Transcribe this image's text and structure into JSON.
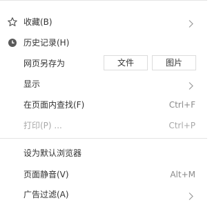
{
  "menu": {
    "items": [
      {
        "label": "收藏(B)",
        "icon": "star-icon",
        "submenu": true
      },
      {
        "label": "历史记录(H)",
        "icon": "history-clock-icon"
      },
      {
        "label": "网页另存为",
        "buttons": [
          "文件",
          "图片"
        ]
      },
      {
        "label": "显示",
        "submenu": true
      },
      {
        "label": "在页面内查找(F)",
        "shortcut": "Ctrl+F"
      },
      {
        "label": "打印(P) ...",
        "shortcut": "Ctrl+P",
        "disabled": true
      },
      {
        "label": "设为默认浏览器"
      },
      {
        "label": "页面静音(V)",
        "shortcut": "Alt+M"
      },
      {
        "label": "广告过滤(A)",
        "submenu": true
      }
    ]
  }
}
